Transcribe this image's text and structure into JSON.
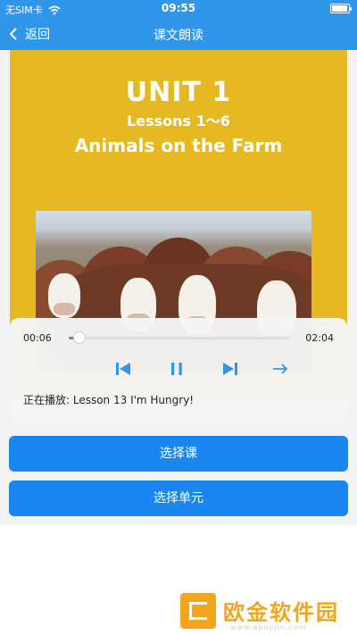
{
  "status": {
    "carrier": "无SIM卡",
    "time": "09:55"
  },
  "nav": {
    "back_label": "返回",
    "title": "课文朗读"
  },
  "book": {
    "unit": "UNIT 1",
    "lessons": "Lessons 1～6",
    "title": "Animals on the Farm"
  },
  "player": {
    "elapsed": "00:06",
    "duration": "02:04",
    "progress": 0.05,
    "now_playing": "正在播放: Lesson 13 I'm Hungry!"
  },
  "buttons": {
    "select_lesson": "选择课",
    "select_unit": "选择单元"
  },
  "watermark": {
    "brand": "欧金软件园",
    "url": "www.apoujin.com"
  },
  "colors": {
    "header": "#2f96ea",
    "button": "#1a86ef",
    "cover": "#e6b923",
    "watermark": "#f2a51c"
  },
  "icons": [
    "chevron-left-icon",
    "wifi-icon",
    "battery-icon",
    "previous-icon",
    "pause-icon",
    "next-icon",
    "arrow-right-icon"
  ]
}
